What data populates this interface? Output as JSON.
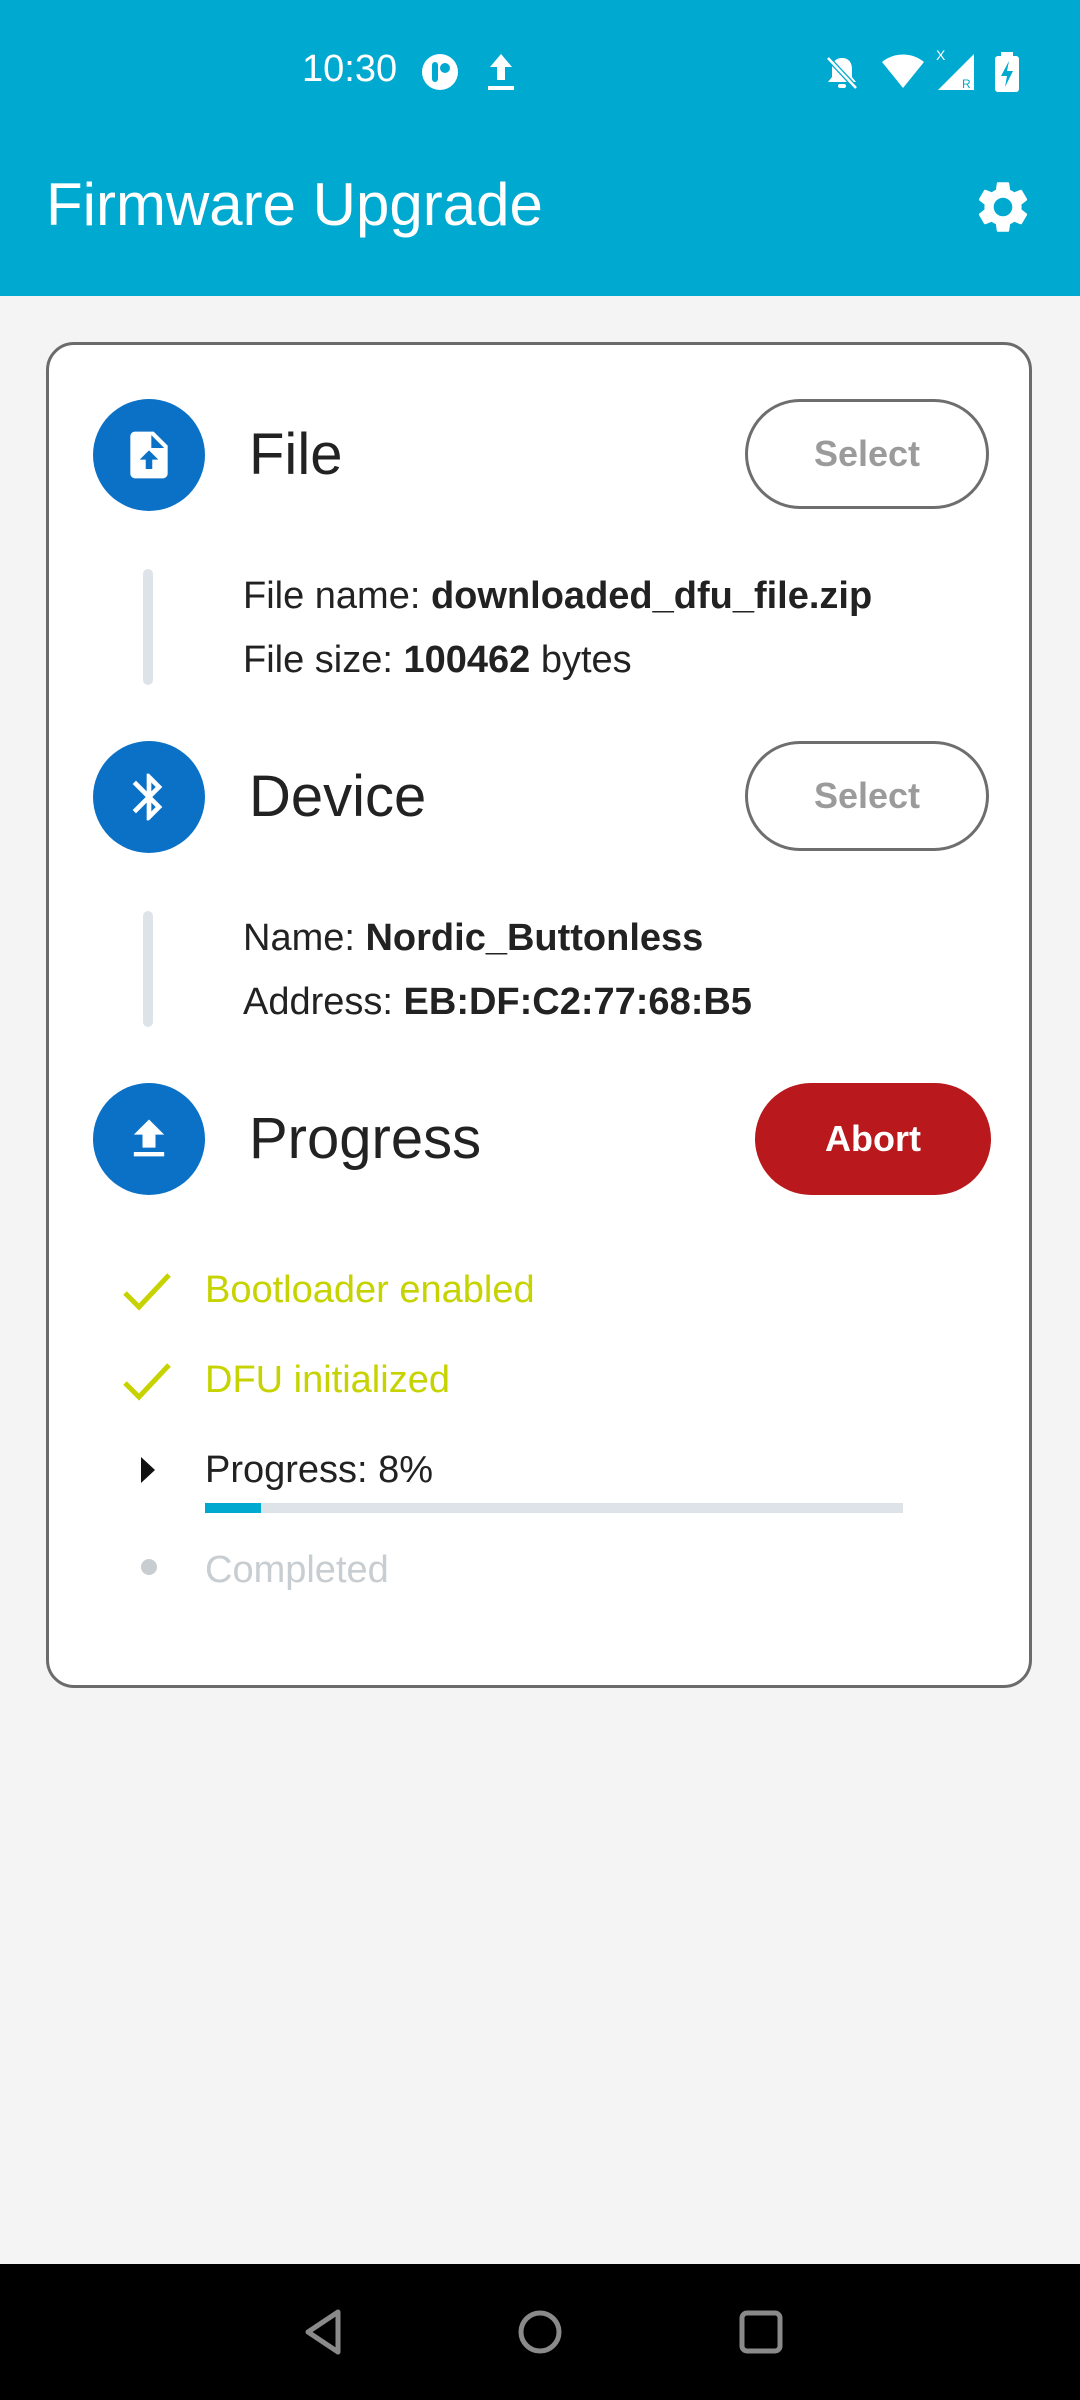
{
  "status_bar": {
    "time": "10:30",
    "icons": [
      "app-notification-icon",
      "upload-icon",
      "notifications-off-icon",
      "wifi-icon",
      "cell-signal-icon",
      "battery-charging-icon"
    ]
  },
  "app_bar": {
    "title": "Firmware Upgrade",
    "action_icon": "settings-icon"
  },
  "steps": {
    "file": {
      "icon": "file-upload-icon",
      "title": "File",
      "button": "Select",
      "name_label": "File name: ",
      "name_value": "downloaded_dfu_file.zip",
      "size_label": "File size: ",
      "size_value": "100462",
      "size_unit": " bytes"
    },
    "device": {
      "icon": "bluetooth-icon",
      "title": "Device",
      "button": "Select",
      "name_label": "Name: ",
      "name_value": "Nordic_Buttonless",
      "address_label": "Address: ",
      "address_value": "EB:DF:C2:77:68:B5"
    },
    "progress": {
      "icon": "upload-icon",
      "title": "Progress",
      "button": "Abort",
      "items": [
        {
          "label": "Bootloader enabled",
          "state": "done"
        },
        {
          "label": "DFU initialized",
          "state": "done"
        },
        {
          "label": "Progress: 8%",
          "state": "active"
        },
        {
          "label": "Completed",
          "state": "pending"
        }
      ],
      "percent": 8
    }
  },
  "nav_bar": {
    "icons": [
      "back-icon",
      "home-icon",
      "recents-icon"
    ]
  },
  "colors": {
    "accent": "#00a9d0",
    "step_icon_bg": "#0a71c7",
    "abort": "#b9191d",
    "done": "#c6d300",
    "pending": "#c7cdd1"
  }
}
